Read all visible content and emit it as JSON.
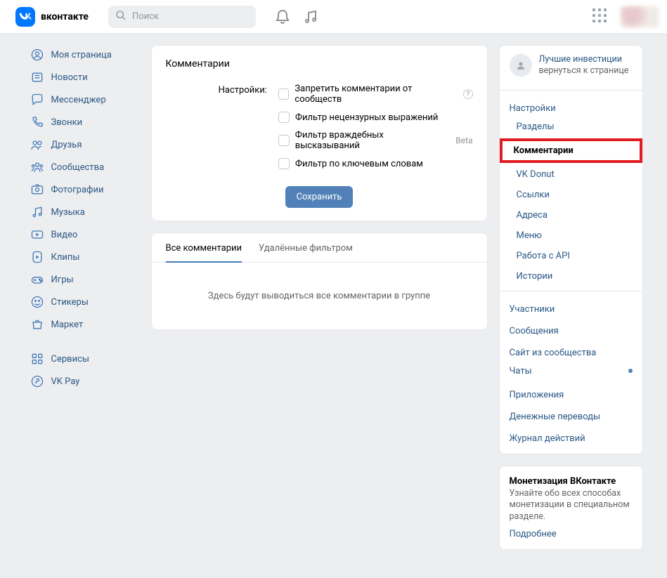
{
  "header": {
    "brand": "вконтакте",
    "search_placeholder": "Поиск"
  },
  "left_nav": {
    "items": [
      {
        "id": "my-page",
        "label": "Моя страница"
      },
      {
        "id": "news",
        "label": "Новости"
      },
      {
        "id": "messenger",
        "label": "Мессенджер"
      },
      {
        "id": "calls",
        "label": "Звонки"
      },
      {
        "id": "friends",
        "label": "Друзья"
      },
      {
        "id": "communities",
        "label": "Сообщества"
      },
      {
        "id": "photos",
        "label": "Фотографии"
      },
      {
        "id": "music",
        "label": "Музыка"
      },
      {
        "id": "video",
        "label": "Видео"
      },
      {
        "id": "clips",
        "label": "Клипы"
      },
      {
        "id": "games",
        "label": "Игры"
      },
      {
        "id": "stickers",
        "label": "Стикеры"
      },
      {
        "id": "market",
        "label": "Маркет"
      }
    ],
    "extra": [
      {
        "id": "services",
        "label": "Сервисы"
      },
      {
        "id": "vkpay",
        "label": "VK Pay"
      }
    ]
  },
  "main": {
    "title": "Комментарии",
    "settings_label": "Настройки:",
    "options": {
      "opt1": "Запретить комментарии от сообществ",
      "opt2": "Фильтр нецензурных выражений",
      "opt3": "Фильтр враждебных высказываний",
      "opt3_badge": "Beta",
      "opt4": "Фильтр по ключевым словам"
    },
    "save": "Сохранить",
    "tabs": {
      "all": "Все комментарии",
      "deleted": "Удалённые фильтром"
    },
    "empty": "Здесь будут выводиться все комментарии в группе"
  },
  "right": {
    "profile": {
      "line1": "Лучшие инвестиции",
      "line2": "вернуться к странице"
    },
    "settings_header": "Настройки",
    "sections": [
      "Разделы",
      "Комментарии",
      "VK Donut",
      "Ссылки",
      "Адреса",
      "Меню",
      "Работа с API",
      "Истории"
    ],
    "root": [
      "Участники",
      "Сообщения",
      "Сайт из сообщества",
      "Чаты",
      "Приложения",
      "Денежные переводы",
      "Журнал действий"
    ],
    "monetization": {
      "title": "Монетизация ВКонтакте",
      "text": "Узнайте обо всех способах монетизации в специальном разделе.",
      "link": "Подробнее"
    }
  }
}
